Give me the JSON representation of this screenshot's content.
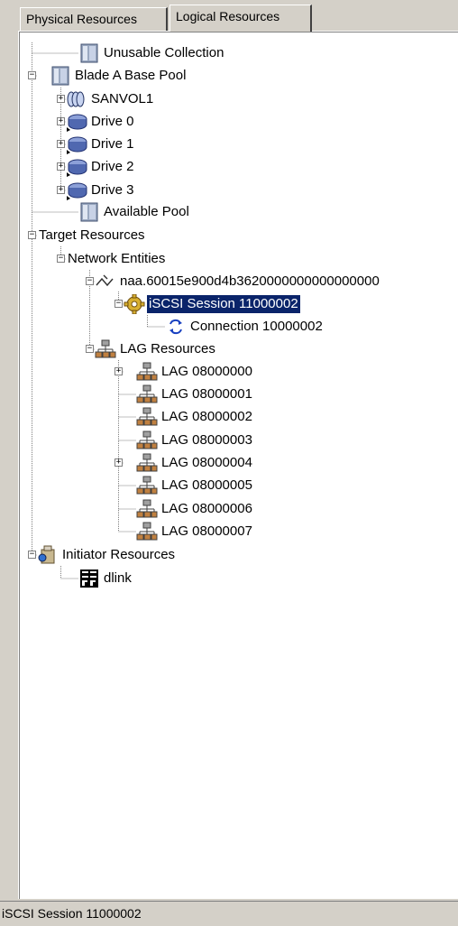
{
  "tabs": [
    {
      "label": "Physical Resources"
    },
    {
      "label": "Logical Resources"
    }
  ],
  "tree": {
    "unusable": "Unusable Collection",
    "blade_pool": "Blade A Base Pool",
    "sanvol": "SANVOL1",
    "drive0": "Drive 0",
    "drive1": "Drive 1",
    "drive2": "Drive 2",
    "drive3": "Drive 3",
    "available": "Available Pool",
    "target": "Target Resources",
    "network": "Network Entities",
    "naa": "naa.60015e900d4b3620000000000000000",
    "session": "iSCSI Session 11000002",
    "connection": "Connection 10000002",
    "lag_resources": "LAG Resources",
    "lags": [
      "LAG 08000000",
      "LAG 08000001",
      "LAG 08000002",
      "LAG 08000003",
      "LAG 08000004",
      "LAG 08000005",
      "LAG 08000006",
      "LAG 08000007"
    ],
    "initiator": "Initiator Resources",
    "dlink": "dlink"
  },
  "status": {
    "text": "iSCSI Session 11000002"
  },
  "colors": {
    "selection": "#0a246a"
  }
}
